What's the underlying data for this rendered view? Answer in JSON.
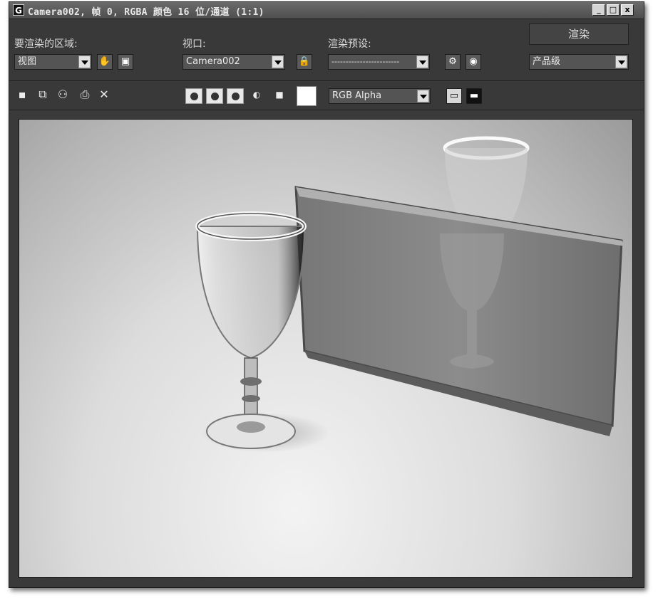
{
  "title": "Camera002, 帧 0, RGBA 颜色 16 位/通道 (1:1)",
  "window_buttons": {
    "minimize": "_",
    "maximize": "□",
    "close": "x"
  },
  "render_area": {
    "label": "要渲染的区域:",
    "value": "视图"
  },
  "viewport_select": {
    "label": "视口:",
    "value": "Camera002"
  },
  "render_preset": {
    "label": "渲染预设:",
    "value": "------------------------"
  },
  "render_button": "渲染",
  "quality": {
    "value": "产品级"
  },
  "channel": {
    "value": "RGB Alpha"
  },
  "icons": {
    "pan": "hand-icon",
    "region": "region-icon",
    "lock": "lock-icon",
    "setup": "render-setup-icon",
    "env": "environment-icon",
    "save": "save-icon",
    "copy": "copy-icon",
    "clone": "clone-icon",
    "print": "print-icon",
    "clear": "close-icon"
  },
  "colors": {
    "panel": "#393939",
    "titlebar": "#5a5a5a"
  }
}
